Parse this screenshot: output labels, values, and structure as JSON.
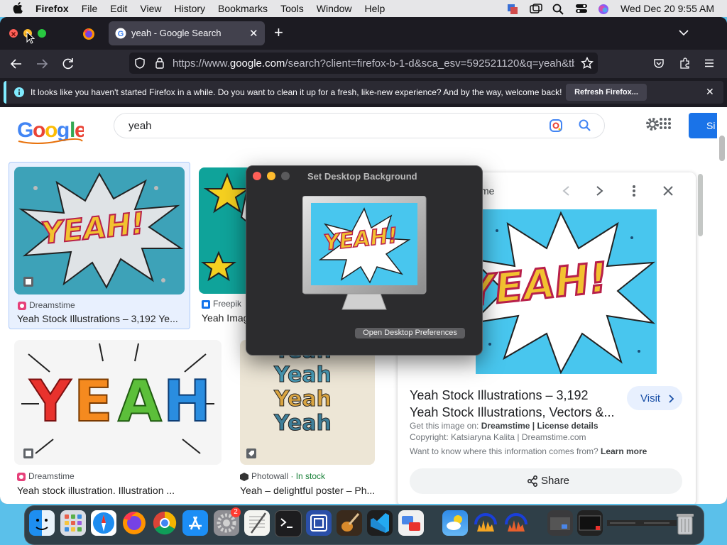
{
  "menubar": {
    "app": "Firefox",
    "items": [
      "File",
      "Edit",
      "View",
      "History",
      "Bookmarks",
      "Tools",
      "Window",
      "Help"
    ],
    "clock": "Wed Dec 20  9:55 AM"
  },
  "browser": {
    "tab_title": "yeah - Google Search",
    "url_prefix": "https://www.",
    "url_domain": "google.com",
    "url_rest": "/search?client=firefox-b-1-d&sca_esv=592521120&q=yeah&tbm",
    "notification": "It looks like you haven't started Firefox in a while. Do you want to clean it up for a fresh, like-new experience? And by the way, welcome back!",
    "refresh_button": "Refresh Firefox..."
  },
  "google": {
    "logo": "Google",
    "query": "yeah",
    "signin": "Si"
  },
  "results": [
    {
      "source": "Dreamstime",
      "title": "Yeah Stock Illustrations – 3,192 Ye..."
    },
    {
      "source": "Freepik",
      "title": "Yeah Imag"
    },
    {
      "source": "Dreamstime",
      "title": "Yeah stock illustration. Illustration ..."
    },
    {
      "source": "Photowall",
      "stock": "· In stock",
      "title": "Yeah – delightful poster – Ph..."
    }
  ],
  "art": {
    "yeah_excl": "YEAH!",
    "yeah_letters": [
      "Y",
      "E",
      "A",
      "H"
    ],
    "yeah_poster": [
      "Yeah",
      "Yeah",
      "Yeah",
      "Yeah"
    ]
  },
  "preview": {
    "header_partial": "time",
    "title_line1": "Yeah Stock Illustrations – 3,192",
    "title_line2": "Yeah Stock Illustrations, Vectors &...",
    "visit": "Visit",
    "get_image_prefix": "Get this image on: ",
    "get_image_source": "Dreamstime",
    "get_image_sep": " | ",
    "license": "License details",
    "copyright": "Copyright: Katsiaryna Kalita | Dreamstime.com",
    "want_to_know": "Want to know where this information comes from? ",
    "learn_more": "Learn more",
    "share": "Share"
  },
  "dialog": {
    "title": "Set Desktop Background",
    "button": "Open Desktop Preferences"
  },
  "dock": {
    "badge": "2"
  },
  "colors": {
    "accent_blue": "#1a73e8",
    "firefox_dark": "#1c1b22",
    "notification_info": "#80ebff"
  }
}
